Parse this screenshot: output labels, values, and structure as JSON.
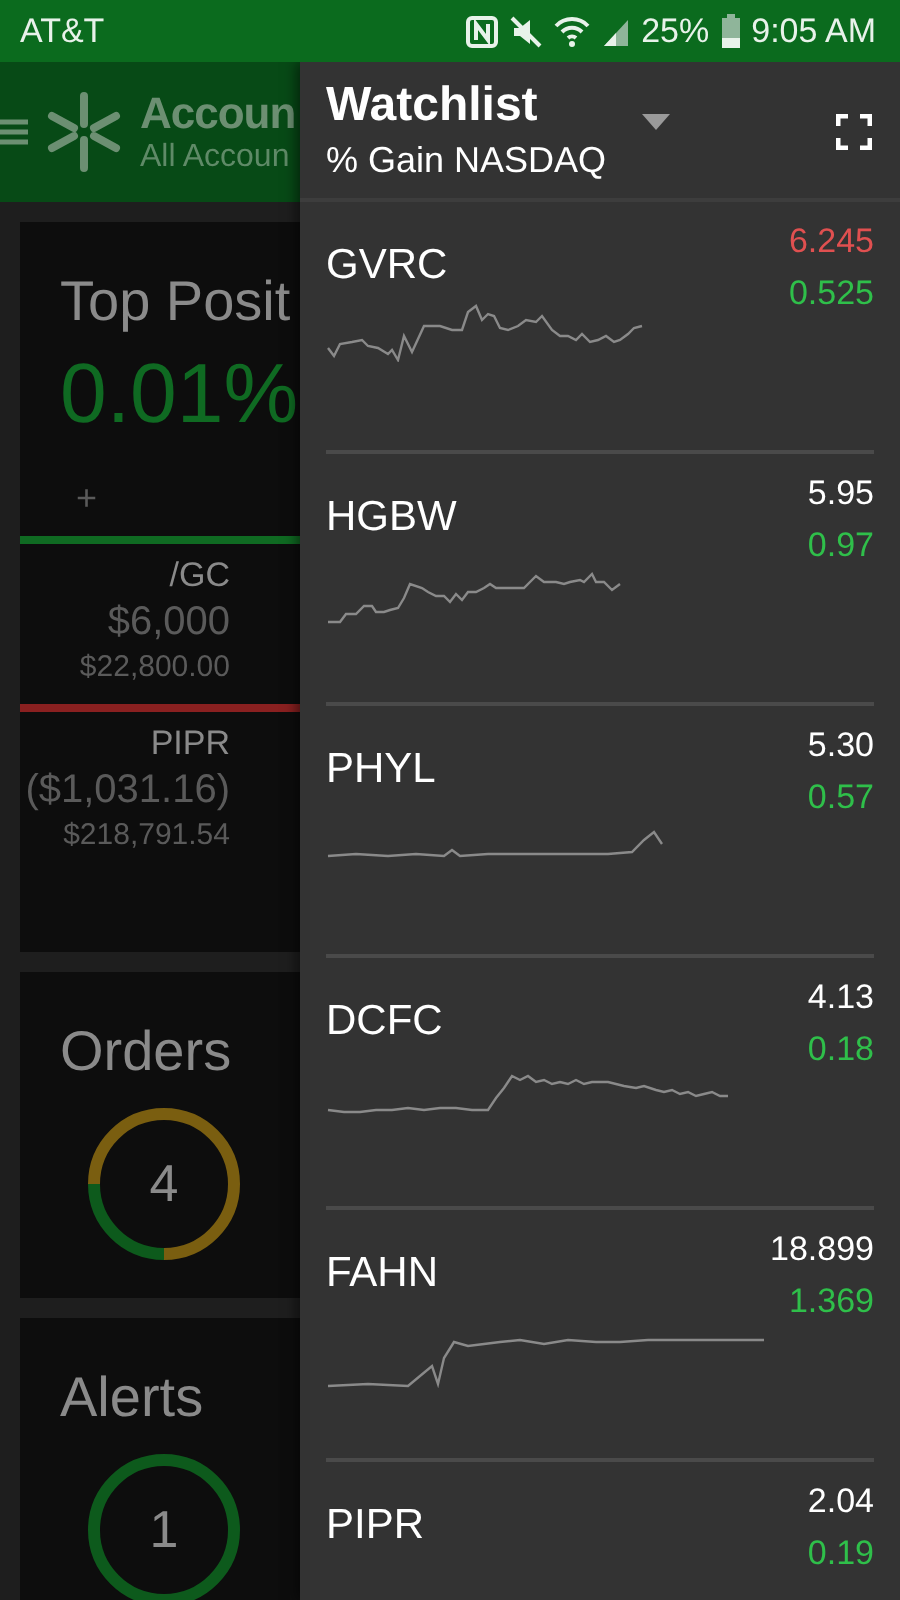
{
  "status_bar": {
    "carrier": "AT&T",
    "battery": "25%",
    "time": "9:05 AM"
  },
  "app_bar": {
    "title": "Accoun",
    "subtitle": "All Accoun"
  },
  "top_positions": {
    "title": "Top Posit",
    "gain": "0.01%",
    "plus": "+",
    "positions": [
      {
        "symbol": "/GC",
        "value": "$6,000",
        "total": "$22,800.00",
        "color": "#0f6a22"
      },
      {
        "symbol": "PIPR",
        "value": "($1,031.16)",
        "total": "$218,791.54",
        "color": "#8a2020"
      }
    ]
  },
  "orders": {
    "title": "Orders",
    "count": "4"
  },
  "alerts": {
    "title": "Alerts",
    "count": "1"
  },
  "watchlist": {
    "title": "Watchlist",
    "list": "% Gain NASDAQ",
    "rows": [
      {
        "symbol": "GVRC",
        "price": "6.245",
        "color": "#e05050",
        "change": "0.525"
      },
      {
        "symbol": "HGBW",
        "price": "5.95",
        "color": "#ffffff",
        "change": "0.97"
      },
      {
        "symbol": "PHYL",
        "price": "5.30",
        "color": "#ffffff",
        "change": "0.57"
      },
      {
        "symbol": "DCFC",
        "price": "4.13",
        "color": "#ffffff",
        "change": "0.18"
      },
      {
        "symbol": "FAHN",
        "price": "18.899",
        "color": "#ffffff",
        "change": "1.369"
      },
      {
        "symbol": "PIPR",
        "price": "2.04",
        "color": "#ffffff",
        "change": "0.19"
      }
    ]
  }
}
